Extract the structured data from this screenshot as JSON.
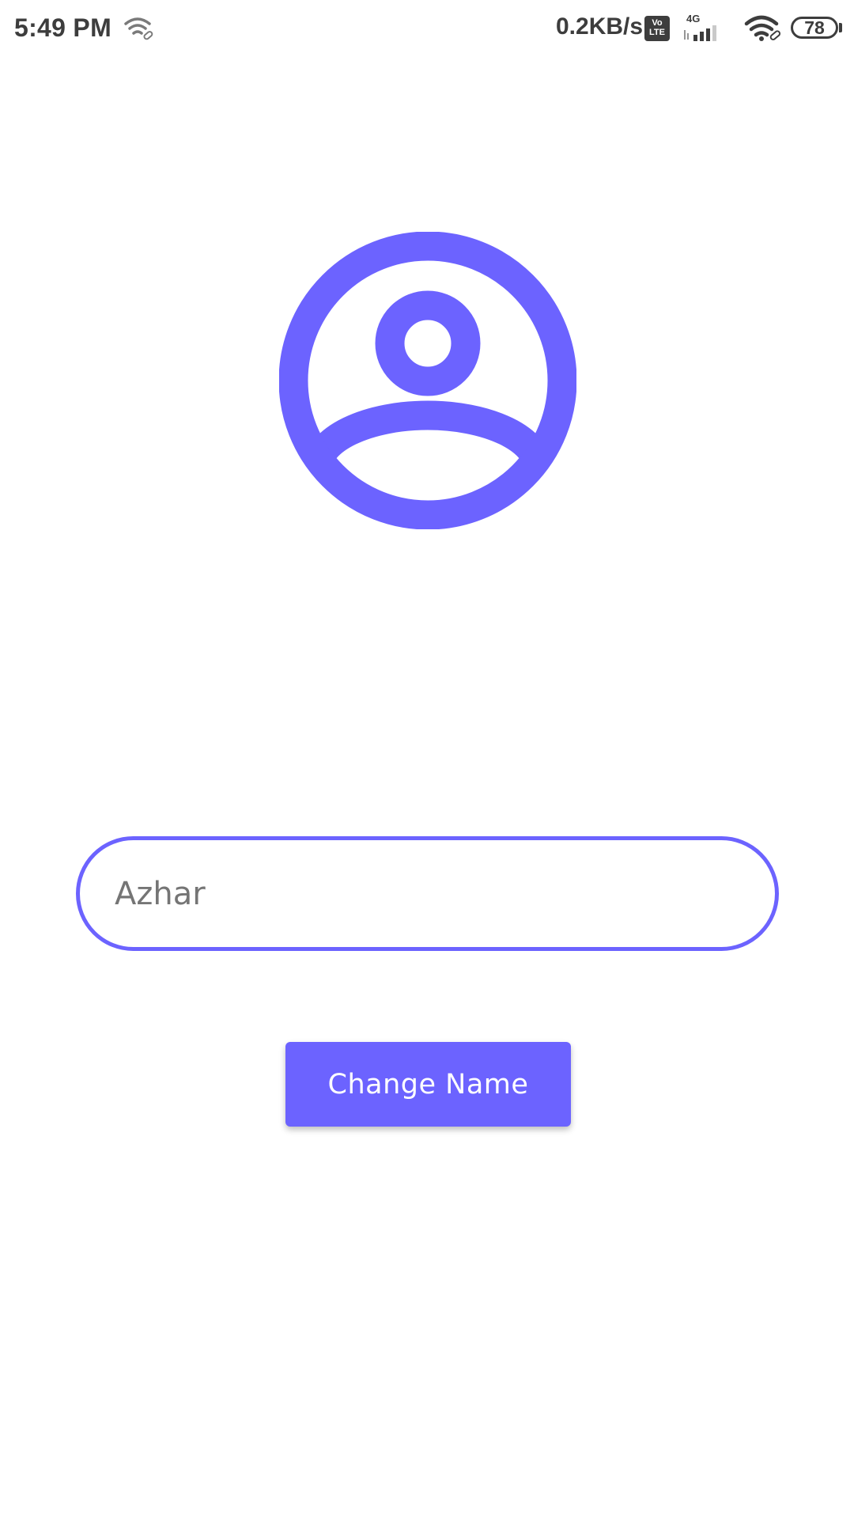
{
  "status_bar": {
    "time": "5:49 PM",
    "network_speed": "0.2KB/s",
    "volte_badge": {
      "top": "Vo",
      "bottom": "LTE"
    },
    "network_type": "4G",
    "battery_level": "78",
    "icons": [
      "wifi-link-icon",
      "volte-icon",
      "cellular-signal-icon",
      "wifi-icon",
      "battery-icon"
    ]
  },
  "profile": {
    "avatar_icon": "user-circle-icon",
    "name_input_placeholder": "Azhar",
    "change_name_label": "Change Name"
  },
  "colors": {
    "accent": "#6c63ff",
    "status_text": "#3d3d3d",
    "input_text": "#757575",
    "background": "#ffffff"
  }
}
